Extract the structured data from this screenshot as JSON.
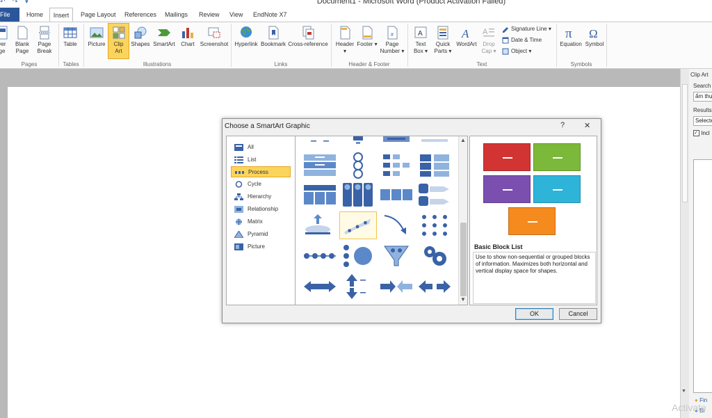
{
  "window": {
    "title": "Document1 - Microsoft Word (Product Activation Failed)"
  },
  "tabs": [
    "File",
    "Home",
    "Insert",
    "Page Layout",
    "References",
    "Mailings",
    "Review",
    "View",
    "EndNote X7"
  ],
  "ribbon": {
    "pages": {
      "cover_l1": "ver",
      "cover_l2": "ge",
      "blank_l1": "Blank",
      "blank_l2": "Page",
      "break_l1": "Page",
      "break_l2": "Break",
      "label": "Pages"
    },
    "tables": {
      "table": "Table",
      "label": "Tables"
    },
    "illustrations": {
      "picture": "Picture",
      "clip_l1": "Clip",
      "clip_l2": "Art",
      "shapes": "Shapes",
      "smartart": "SmartArt",
      "chart": "Chart",
      "screenshot": "Screenshot",
      "label": "Illustrations"
    },
    "links": {
      "hyperlink": "Hyperlink",
      "bookmark": "Bookmark",
      "crossref": "Cross-reference",
      "label": "Links"
    },
    "header_footer": {
      "header": "Header",
      "footer": "Footer",
      "pagenum_l1": "Page",
      "pagenum_l2": "Number",
      "label": "Header & Footer"
    },
    "text": {
      "textbox_l1": "Text",
      "textbox_l2": "Box",
      "quick_l1": "Quick",
      "quick_l2": "Parts",
      "wordart": "WordArt",
      "drop_l1": "Drop",
      "drop_l2": "Cap",
      "signature": "Signature Line",
      "datetime": "Date & Time",
      "object": "Object",
      "label": "Text"
    },
    "symbols": {
      "equation": "Equation",
      "symbol": "Symbol",
      "label": "Symbols"
    }
  },
  "clip_pane": {
    "title": "Clip Art",
    "search_label": "Search",
    "search_value": "ẩm thự",
    "results_label": "Results",
    "results_value": "Selecte",
    "include_label": "Incl",
    "link1": "Fin",
    "link2": "Bi"
  },
  "dialog": {
    "title": "Choose a SmartArt Graphic",
    "help": "?",
    "close": "✕",
    "categories": [
      "All",
      "List",
      "Process",
      "Cycle",
      "Hierarchy",
      "Relationship",
      "Matrix",
      "Pyramid",
      "Picture"
    ],
    "selected_category": "Process",
    "preview_name": "Basic Block List",
    "preview_desc": "Use to show non-sequential or grouped blocks of information. Maximizes both horizontal and vertical display space for shapes.",
    "ok": "OK",
    "cancel": "Cancel"
  },
  "watermark": "Activate",
  "colors": {
    "red": "#d23434",
    "green": "#7cb93a",
    "purple": "#7b4fb0",
    "teal": "#2eb4d8",
    "orange": "#f58a1f",
    "accent": "#2b579a",
    "thumb_blue": "#3a62a6"
  }
}
